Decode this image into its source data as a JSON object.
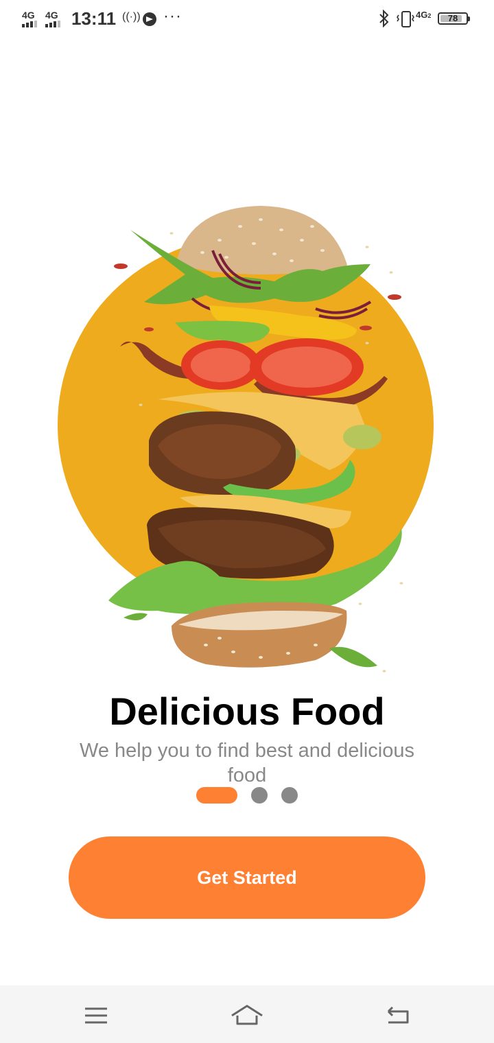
{
  "status_bar": {
    "sim1_label": "4G",
    "sim2_label": "4G",
    "time": "13:11",
    "hotspot_icon": "hotspot-icon",
    "telegram_icon": "telegram-icon",
    "more_indicator": "···",
    "bluetooth_icon": "bluetooth-icon",
    "vibrate_icon": "vibrate-icon",
    "network2_label": "4G",
    "network2_sub": "2",
    "battery_level": "78"
  },
  "hero": {
    "image": "burger-illustration",
    "circle_color": "#eeab1d"
  },
  "onboarding": {
    "title": "Delicious Food",
    "subtitle": "We help you to find best and delicious food",
    "pages_total": 3,
    "active_page": 1,
    "active_color": "#fe8133",
    "inactive_color": "#888888"
  },
  "cta": {
    "label": "Get Started",
    "color": "#fe8133"
  },
  "nav_bar": {
    "menu_icon": "menu-icon",
    "home_icon": "home-icon",
    "back_icon": "back-icon"
  }
}
